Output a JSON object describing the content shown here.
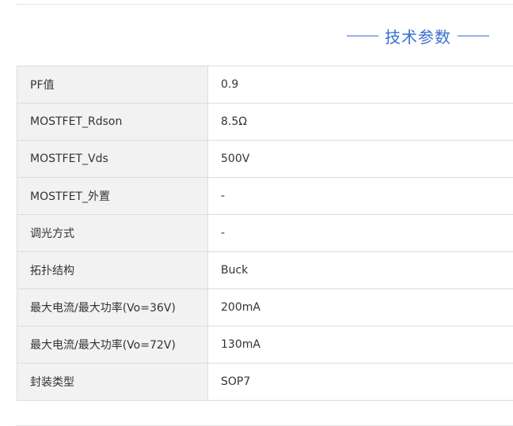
{
  "section": {
    "title": "技术参数"
  },
  "specs": [
    {
      "key": "PF值",
      "value": "0.9"
    },
    {
      "key": "MOSTFET_Rdson",
      "value": "8.5Ω"
    },
    {
      "key": "MOSTFET_Vds",
      "value": "500V"
    },
    {
      "key": "MOSTFET_外置",
      "value": "-"
    },
    {
      "key": "调光方式",
      "value": "-"
    },
    {
      "key": "拓扑结构",
      "value": "Buck"
    },
    {
      "key": "最大电流/最大功率(Vo=36V)",
      "value": "200mA"
    },
    {
      "key": "最大电流/最大功率(Vo=72V)",
      "value": "130mA"
    },
    {
      "key": "封装类型",
      "value": "SOP7"
    }
  ],
  "colors": {
    "accent": "#3a6fd0",
    "key_background": "#f2f2f2",
    "border": "#dcdcdc",
    "text": "#333333"
  }
}
